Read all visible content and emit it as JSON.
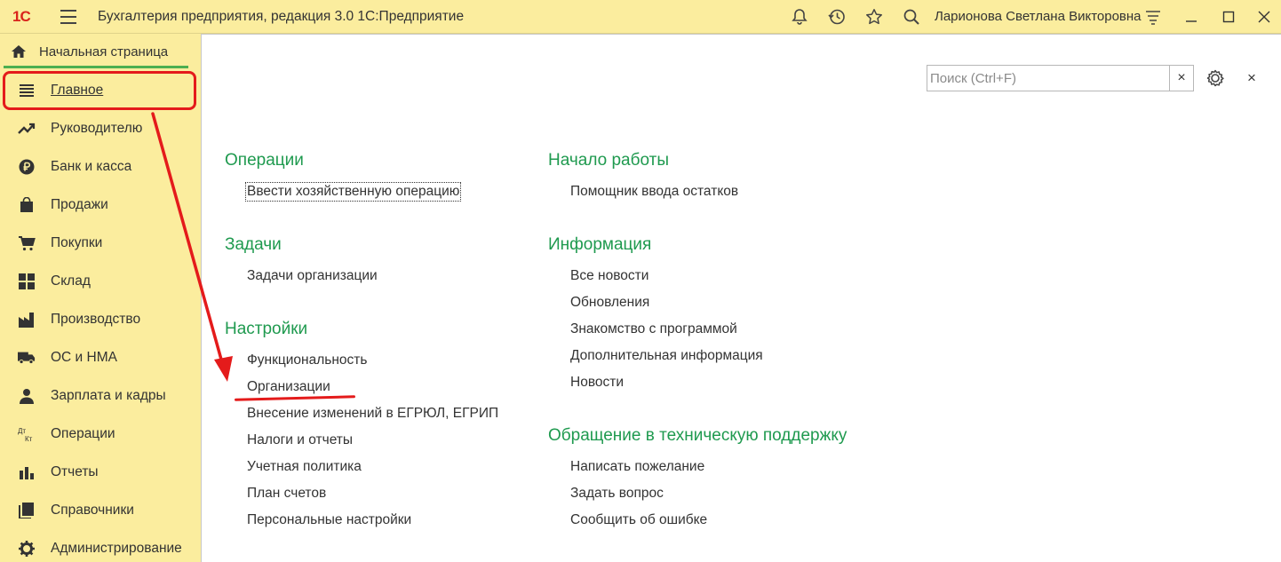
{
  "titlebar": {
    "logo": "1С",
    "title": "Бухгалтерия предприятия, редакция 3.0 1С:Предприятие",
    "user": "Ларионова Светлана Викторовна",
    "icons": [
      "bell-icon",
      "history-icon",
      "star-icon",
      "search-icon",
      "settings-menu-icon"
    ]
  },
  "home_tab": {
    "label": "Начальная страница"
  },
  "sidebar": {
    "items": [
      {
        "label": "Главное",
        "icon": "menu-lines-icon"
      },
      {
        "label": "Руководителю",
        "icon": "trend-icon"
      },
      {
        "label": "Банк и касса",
        "icon": "ruble-icon"
      },
      {
        "label": "Продажи",
        "icon": "bag-icon"
      },
      {
        "label": "Покупки",
        "icon": "cart-icon"
      },
      {
        "label": "Склад",
        "icon": "grid-icon"
      },
      {
        "label": "Производство",
        "icon": "factory-icon"
      },
      {
        "label": "ОС и НМА",
        "icon": "truck-icon"
      },
      {
        "label": "Зарплата и кадры",
        "icon": "person-icon"
      },
      {
        "label": "Операции",
        "icon": "dt-kt-icon"
      },
      {
        "label": "Отчеты",
        "icon": "bar-chart-icon"
      },
      {
        "label": "Справочники",
        "icon": "books-icon"
      },
      {
        "label": "Администрирование",
        "icon": "gear-icon"
      }
    ]
  },
  "search": {
    "placeholder": "Поиск (Ctrl+F)",
    "clear": "×"
  },
  "main": {
    "close": "×",
    "sections_left": [
      {
        "title": "Операции",
        "links": [
          "Ввести хозяйственную операцию"
        ]
      },
      {
        "title": "Задачи",
        "links": [
          "Задачи организации"
        ]
      },
      {
        "title": "Настройки",
        "links": [
          "Функциональность",
          "Организации",
          "Внесение изменений в ЕГРЮЛ, ЕГРИП",
          "Налоги и отчеты",
          "Учетная политика",
          "План счетов",
          "Персональные настройки"
        ]
      }
    ],
    "sections_right": [
      {
        "title": "Начало работы",
        "links": [
          "Помощник ввода остатков"
        ]
      },
      {
        "title": "Информация",
        "links": [
          "Все новости",
          "Обновления",
          "Знакомство с программой",
          "Дополнительная информация",
          "Новости"
        ]
      },
      {
        "title": "Обращение в техническую поддержку",
        "links": [
          "Написать пожелание",
          "Задать вопрос",
          "Сообщить об ошибке"
        ]
      }
    ]
  },
  "colors": {
    "accent_green": "#1f9a4f",
    "annotation_red": "#e41b1b",
    "sidebar_bg": "#fbed9e"
  }
}
